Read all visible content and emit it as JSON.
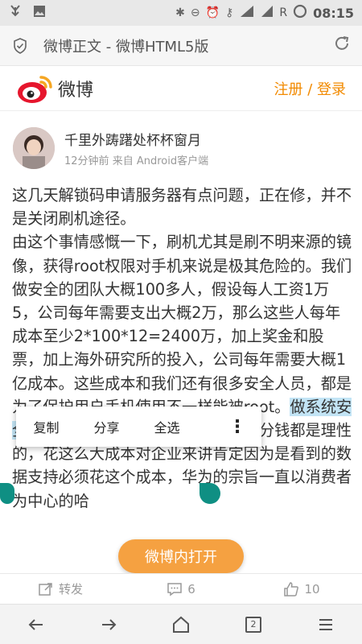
{
  "status_bar": {
    "time": "08:15",
    "carrier_letter": "R"
  },
  "browser": {
    "title": "微博正文 - 微博HTML5版"
  },
  "header": {
    "logo_text": "微博",
    "auth_links": "注册 / 登录"
  },
  "post": {
    "author": "千里外踌躇处杯杯窗月",
    "time_ago": "12分钟前",
    "source_prefix": "来自",
    "source": "Android客户端",
    "paragraph1": "这几天解锁码申请服务器有点问题，正在修，并不是关闭刷机途径。",
    "paragraph2a": "由这个事情感慨一下，刷机尤其是刷不明来源的镜像，获得root权限对手机来说是极其危险的。我们做安全的团队大概100多人，假设每人工资1万5，公司每年需要支出大概2万，那么这些人每年成本至少2*100*12=2400万，加上奖金和股票，加上海外研究所的投入，公司每年需要大概1亿成本。这些成本和我们还有很多安全人员，都是为了保护用户手机使用不一样能被root。",
    "highlighted": "做系统安全不能说太细，",
    "paragraph2b": "只能说企业花的每一分钱都是理性的，花这么大成本对企业来讲肯定因为是看到的数据支持必须花这个成本，华为的宗旨一直以消费者为中心的哈"
  },
  "context_menu": {
    "copy": "复制",
    "share": "分享",
    "select_all": "全选"
  },
  "open_app_button": "微博内打开",
  "actions": {
    "repost": "转发",
    "comments": "6",
    "likes": "10"
  },
  "nav": {
    "tab_count": "2"
  },
  "colors": {
    "accent": "#f28a00",
    "handle": "#0f8f83",
    "highlight": "#c2e4f5",
    "open_button": "#f5a141"
  }
}
